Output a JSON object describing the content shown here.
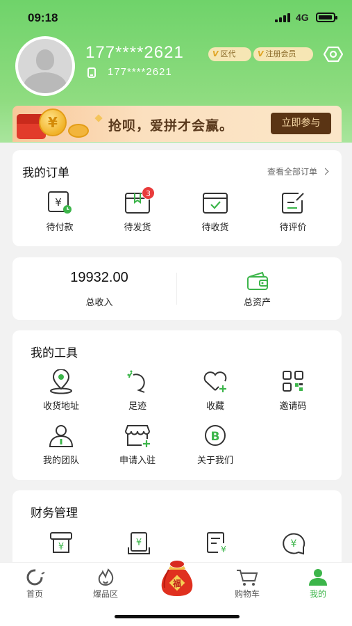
{
  "status_bar": {
    "time": "09:18",
    "network": "4G"
  },
  "profile": {
    "name": "177****2621",
    "phone": "177****2621",
    "tags": [
      "区代",
      "注册会员"
    ]
  },
  "banner": {
    "text": "抢呗，爱拼才会赢。",
    "button": "立即参与"
  },
  "orders": {
    "title": "我的订单",
    "view_all": "查看全部订单",
    "items": [
      {
        "label": "待付款",
        "icon": "pending-payment-icon"
      },
      {
        "label": "待发货",
        "icon": "pending-shipment-icon",
        "badge": "3"
      },
      {
        "label": "待收货",
        "icon": "pending-receipt-icon"
      },
      {
        "label": "待评价",
        "icon": "pending-review-icon"
      }
    ]
  },
  "income": {
    "value": "19932.00",
    "label": "总收入",
    "assets_label": "总资产"
  },
  "tools": {
    "title": "我的工具",
    "items": [
      {
        "label": "收货地址",
        "icon": "location-icon"
      },
      {
        "label": "足迹",
        "icon": "footprint-icon"
      },
      {
        "label": "收藏",
        "icon": "favorite-icon"
      },
      {
        "label": "邀请码",
        "icon": "qr-code-icon"
      },
      {
        "label": "我的团队",
        "icon": "team-icon"
      },
      {
        "label": "申请入驻",
        "icon": "store-apply-icon"
      },
      {
        "label": "关于我们",
        "icon": "about-icon"
      }
    ]
  },
  "finance": {
    "title": "财务管理"
  },
  "tabbar": {
    "items": [
      {
        "label": "首页",
        "icon": "home-icon"
      },
      {
        "label": "爆品区",
        "icon": "fire-icon"
      },
      {
        "label": "",
        "icon": "lucky-bag-icon"
      },
      {
        "label": "购物车",
        "icon": "cart-icon"
      },
      {
        "label": "我的",
        "icon": "profile-icon",
        "active": true
      }
    ]
  },
  "colors": {
    "accent": "#3cb54a",
    "header": "#6fd36a",
    "badge": "#e93b3b",
    "banner_button": "#5a3414"
  }
}
